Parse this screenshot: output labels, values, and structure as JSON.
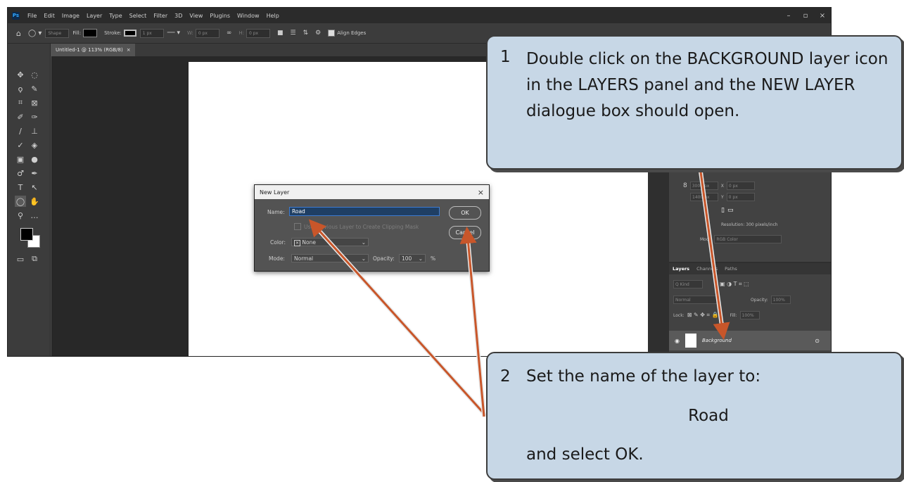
{
  "menubar": {
    "logo": "Ps",
    "items": [
      "File",
      "Edit",
      "Image",
      "Layer",
      "Type",
      "Select",
      "Filter",
      "3D",
      "View",
      "Plugins",
      "Window",
      "Help"
    ]
  },
  "options_bar": {
    "shape_label": "Shape",
    "fill_label": "Fill:",
    "stroke_label": "Stroke:",
    "stroke_width": "1 px",
    "w_label": "W:",
    "w_value": "0 px",
    "h_label": "H:",
    "h_value": "0 px",
    "align_edges": "Align Edges"
  },
  "document_tab": {
    "title": "Untitled-1 @ 113% (RGB/8)",
    "close": "×"
  },
  "properties": {
    "w_value": "3000 px",
    "h_value": "1400 px",
    "x_label": "X",
    "x_value": "0 px",
    "y_label": "Y",
    "y_value": "0 px",
    "resolution": "Resolution: 300 pixels/inch",
    "mode_label": "Mode",
    "mode_value": "RGB Color"
  },
  "layers_panel": {
    "tabs": [
      "Layers",
      "Channels",
      "Paths"
    ],
    "kind_label": "Q Kind",
    "blend_mode": "Normal",
    "opacity_label": "Opacity:",
    "opacity_value": "100%",
    "lock_label": "Lock:",
    "fill_label": "Fill:",
    "fill_value": "100%",
    "layer_name": "Background"
  },
  "dialog": {
    "title": "New Layer",
    "close": "×",
    "name_label": "Name:",
    "name_value": "Road",
    "clip_label": "Use Previous Layer to Create Clipping Mask",
    "color_label": "Color:",
    "color_value": "None",
    "mode_label": "Mode:",
    "mode_value": "Normal",
    "opacity_label": "Opacity:",
    "opacity_value": "100",
    "opacity_unit": "%",
    "ok_label": "OK",
    "cancel_label": "Cancel"
  },
  "callout1": {
    "number": "1",
    "text": "Double click on the BACKGROUND layer icon in the LAYERS panel and the NEW LAYER dialogue box should open."
  },
  "callout2": {
    "number": "2",
    "line1": "Set the name of the layer to:",
    "line2": "Road",
    "line3": "and select OK."
  },
  "colors": {
    "arrow": "#c8562a",
    "callout_bg": "#c7d7e6",
    "ps_dark": "#2b2b2b",
    "name_field_border": "#3d7bd0"
  }
}
